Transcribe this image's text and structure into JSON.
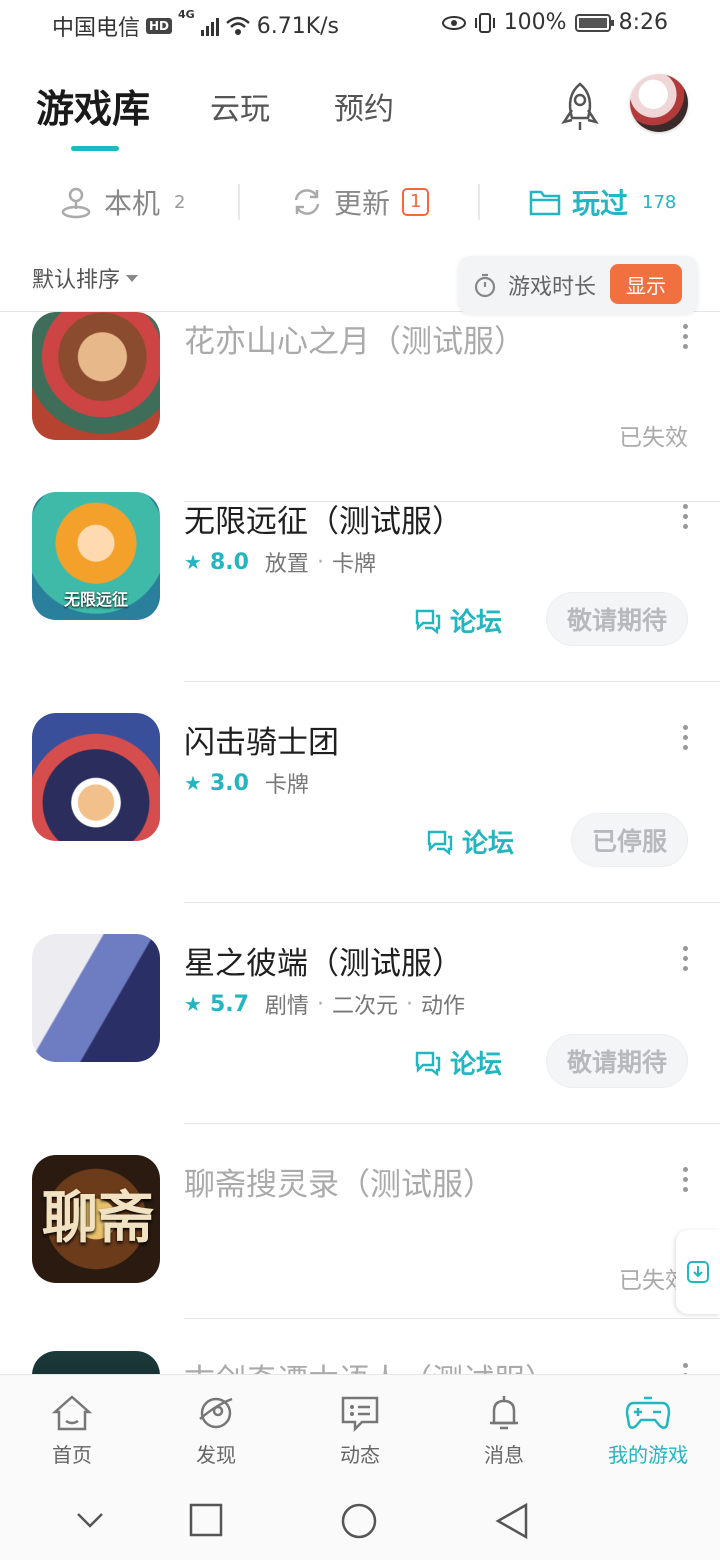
{
  "status_bar": {
    "carrier": "中国电信",
    "hd": "HD",
    "network": "4G",
    "speed": "6.71K/s",
    "battery": "100%",
    "time": "8:26"
  },
  "top_tabs": [
    {
      "label": "游戏库",
      "active": true
    },
    {
      "label": "云玩",
      "active": false
    },
    {
      "label": "预约",
      "active": false
    }
  ],
  "filters": {
    "local": {
      "label": "本机",
      "count": "2"
    },
    "update": {
      "label": "更新",
      "badge": "1"
    },
    "played": {
      "label": "玩过",
      "count": "178",
      "active": true
    }
  },
  "sort": {
    "label": "默认排序"
  },
  "duration": {
    "label": "游戏时长",
    "toggle": "显示"
  },
  "games": [
    {
      "title": "花亦山心之月（测试服）",
      "state": "invalid",
      "status": "已失效",
      "icon": "art1"
    },
    {
      "title": "无限远征（测试服）",
      "state": "active",
      "rating": "8.0",
      "tags": [
        "放置",
        "卡牌"
      ],
      "forum": "论坛",
      "action": "敬请期待",
      "icon": "art2",
      "icon_text": "无限远征"
    },
    {
      "title": "闪击骑士团",
      "state": "active",
      "rating": "3.0",
      "tags": [
        "卡牌"
      ],
      "forum": "论坛",
      "action": "已停服",
      "icon": "art3"
    },
    {
      "title": "星之彼端（测试服）",
      "state": "active",
      "rating": "5.7",
      "tags": [
        "剧情",
        "二次元",
        "动作"
      ],
      "forum": "论坛",
      "action": "敬请期待",
      "icon": "art4"
    },
    {
      "title": "聊斋搜灵录（测试服）",
      "state": "invalid",
      "status": "已失效",
      "icon": "art5",
      "icon_text": "聊斋"
    },
    {
      "title": "古剑奇谭木语人（测试服）",
      "state": "invalid",
      "status": "",
      "icon": "art6"
    }
  ],
  "bottom_nav": [
    {
      "label": "首页",
      "icon": "home-icon"
    },
    {
      "label": "发现",
      "icon": "discover-icon"
    },
    {
      "label": "动态",
      "icon": "feed-icon"
    },
    {
      "label": "消息",
      "icon": "bell-icon"
    },
    {
      "label": "我的游戏",
      "icon": "gamepad-icon",
      "active": true
    }
  ],
  "colors": {
    "accent": "#23b6c0",
    "orange": "#f0713f"
  }
}
